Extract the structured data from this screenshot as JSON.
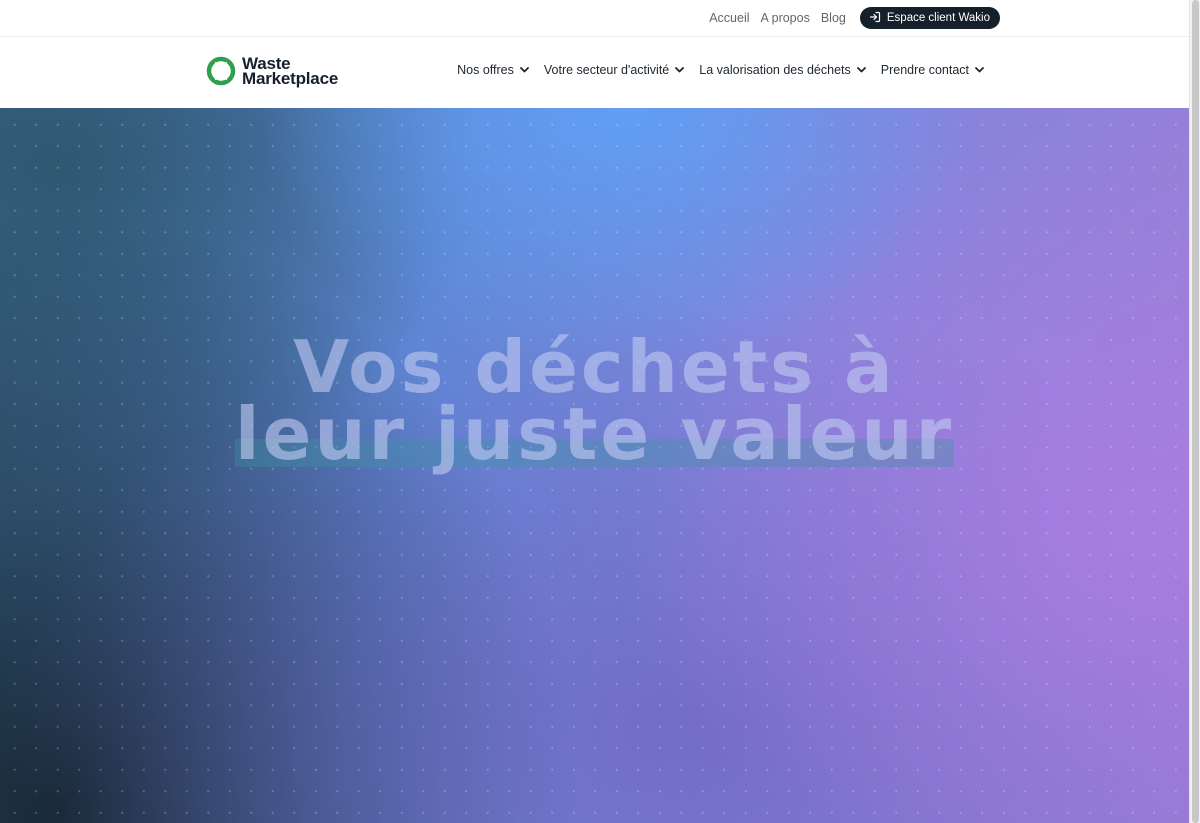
{
  "topbar": {
    "links": [
      {
        "label": "Accueil"
      },
      {
        "label": "A propos"
      },
      {
        "label": "Blog"
      }
    ],
    "client_button": {
      "label": "Espace client Wakio",
      "icon": "login-icon"
    }
  },
  "header": {
    "logo": {
      "line1": "Waste",
      "line2": "Marketplace",
      "icon": "ring-logo-icon",
      "color": "#2e9e4f"
    },
    "nav": [
      {
        "label": "Nos offres",
        "icon": "chevron-down-icon"
      },
      {
        "label": "Votre secteur d'activité",
        "icon": "chevron-down-icon"
      },
      {
        "label": "La valorisation des déchets",
        "icon": "chevron-down-icon"
      },
      {
        "label": "Prendre contact",
        "icon": "chevron-down-icon"
      }
    ]
  },
  "hero": {
    "title_line1": "Vos déchets à",
    "title_line2": "leur juste valeur",
    "colors": {
      "blue": "#5fa0f5",
      "violet": "#aa7de1",
      "dark": "#14232d"
    }
  },
  "colors": {
    "button_bg": "#15202b",
    "text": "#1d2630",
    "muted": "#666666"
  }
}
